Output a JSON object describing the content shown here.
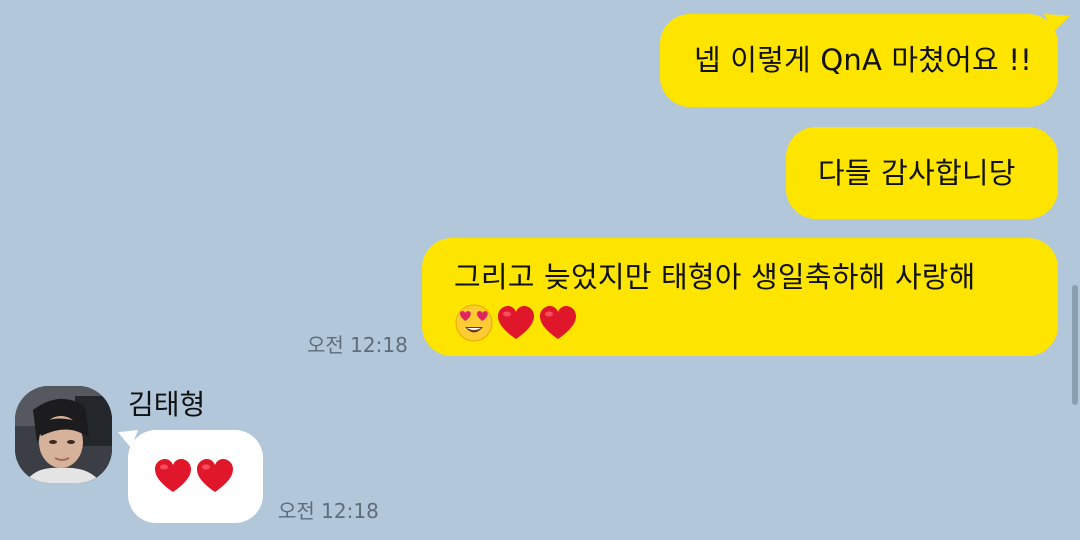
{
  "chat": {
    "background": "#b2c7da",
    "my_bubble_color": "#fee500",
    "their_bubble_color": "#ffffff",
    "outgoing": [
      {
        "text": "넵 이렇게 QnA 마쳤어요 !!"
      },
      {
        "text": "다들 감사합니당"
      },
      {
        "text": "그리고 늦었지만 태형아 생일축하해 사랑해",
        "emojis": [
          "heart-eyes-emoji",
          "red-heart-emoji",
          "red-heart-emoji"
        ]
      }
    ],
    "outgoing_time": "오전 12:18",
    "incoming": {
      "sender": "김태형",
      "emojis": [
        "red-heart-emoji",
        "red-heart-emoji"
      ],
      "time": "오전 12:18"
    }
  }
}
